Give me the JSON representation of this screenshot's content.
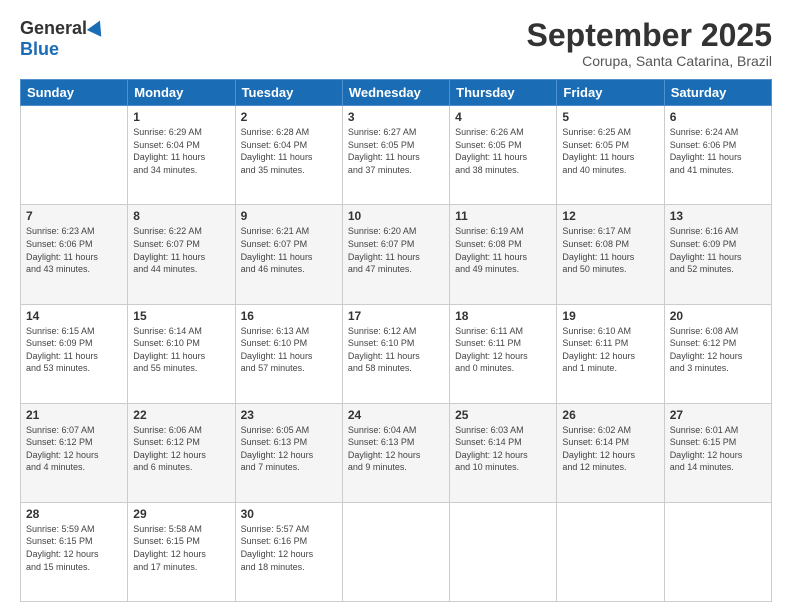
{
  "logo": {
    "general": "General",
    "blue": "Blue"
  },
  "header": {
    "month": "September 2025",
    "location": "Corupa, Santa Catarina, Brazil"
  },
  "weekdays": [
    "Sunday",
    "Monday",
    "Tuesday",
    "Wednesday",
    "Thursday",
    "Friday",
    "Saturday"
  ],
  "weeks": [
    [
      {
        "day": "",
        "info": ""
      },
      {
        "day": "1",
        "info": "Sunrise: 6:29 AM\nSunset: 6:04 PM\nDaylight: 11 hours\nand 34 minutes."
      },
      {
        "day": "2",
        "info": "Sunrise: 6:28 AM\nSunset: 6:04 PM\nDaylight: 11 hours\nand 35 minutes."
      },
      {
        "day": "3",
        "info": "Sunrise: 6:27 AM\nSunset: 6:05 PM\nDaylight: 11 hours\nand 37 minutes."
      },
      {
        "day": "4",
        "info": "Sunrise: 6:26 AM\nSunset: 6:05 PM\nDaylight: 11 hours\nand 38 minutes."
      },
      {
        "day": "5",
        "info": "Sunrise: 6:25 AM\nSunset: 6:05 PM\nDaylight: 11 hours\nand 40 minutes."
      },
      {
        "day": "6",
        "info": "Sunrise: 6:24 AM\nSunset: 6:06 PM\nDaylight: 11 hours\nand 41 minutes."
      }
    ],
    [
      {
        "day": "7",
        "info": "Sunrise: 6:23 AM\nSunset: 6:06 PM\nDaylight: 11 hours\nand 43 minutes."
      },
      {
        "day": "8",
        "info": "Sunrise: 6:22 AM\nSunset: 6:07 PM\nDaylight: 11 hours\nand 44 minutes."
      },
      {
        "day": "9",
        "info": "Sunrise: 6:21 AM\nSunset: 6:07 PM\nDaylight: 11 hours\nand 46 minutes."
      },
      {
        "day": "10",
        "info": "Sunrise: 6:20 AM\nSunset: 6:07 PM\nDaylight: 11 hours\nand 47 minutes."
      },
      {
        "day": "11",
        "info": "Sunrise: 6:19 AM\nSunset: 6:08 PM\nDaylight: 11 hours\nand 49 minutes."
      },
      {
        "day": "12",
        "info": "Sunrise: 6:17 AM\nSunset: 6:08 PM\nDaylight: 11 hours\nand 50 minutes."
      },
      {
        "day": "13",
        "info": "Sunrise: 6:16 AM\nSunset: 6:09 PM\nDaylight: 11 hours\nand 52 minutes."
      }
    ],
    [
      {
        "day": "14",
        "info": "Sunrise: 6:15 AM\nSunset: 6:09 PM\nDaylight: 11 hours\nand 53 minutes."
      },
      {
        "day": "15",
        "info": "Sunrise: 6:14 AM\nSunset: 6:10 PM\nDaylight: 11 hours\nand 55 minutes."
      },
      {
        "day": "16",
        "info": "Sunrise: 6:13 AM\nSunset: 6:10 PM\nDaylight: 11 hours\nand 57 minutes."
      },
      {
        "day": "17",
        "info": "Sunrise: 6:12 AM\nSunset: 6:10 PM\nDaylight: 11 hours\nand 58 minutes."
      },
      {
        "day": "18",
        "info": "Sunrise: 6:11 AM\nSunset: 6:11 PM\nDaylight: 12 hours\nand 0 minutes."
      },
      {
        "day": "19",
        "info": "Sunrise: 6:10 AM\nSunset: 6:11 PM\nDaylight: 12 hours\nand 1 minute."
      },
      {
        "day": "20",
        "info": "Sunrise: 6:08 AM\nSunset: 6:12 PM\nDaylight: 12 hours\nand 3 minutes."
      }
    ],
    [
      {
        "day": "21",
        "info": "Sunrise: 6:07 AM\nSunset: 6:12 PM\nDaylight: 12 hours\nand 4 minutes."
      },
      {
        "day": "22",
        "info": "Sunrise: 6:06 AM\nSunset: 6:12 PM\nDaylight: 12 hours\nand 6 minutes."
      },
      {
        "day": "23",
        "info": "Sunrise: 6:05 AM\nSunset: 6:13 PM\nDaylight: 12 hours\nand 7 minutes."
      },
      {
        "day": "24",
        "info": "Sunrise: 6:04 AM\nSunset: 6:13 PM\nDaylight: 12 hours\nand 9 minutes."
      },
      {
        "day": "25",
        "info": "Sunrise: 6:03 AM\nSunset: 6:14 PM\nDaylight: 12 hours\nand 10 minutes."
      },
      {
        "day": "26",
        "info": "Sunrise: 6:02 AM\nSunset: 6:14 PM\nDaylight: 12 hours\nand 12 minutes."
      },
      {
        "day": "27",
        "info": "Sunrise: 6:01 AM\nSunset: 6:15 PM\nDaylight: 12 hours\nand 14 minutes."
      }
    ],
    [
      {
        "day": "28",
        "info": "Sunrise: 5:59 AM\nSunset: 6:15 PM\nDaylight: 12 hours\nand 15 minutes."
      },
      {
        "day": "29",
        "info": "Sunrise: 5:58 AM\nSunset: 6:15 PM\nDaylight: 12 hours\nand 17 minutes."
      },
      {
        "day": "30",
        "info": "Sunrise: 5:57 AM\nSunset: 6:16 PM\nDaylight: 12 hours\nand 18 minutes."
      },
      {
        "day": "",
        "info": ""
      },
      {
        "day": "",
        "info": ""
      },
      {
        "day": "",
        "info": ""
      },
      {
        "day": "",
        "info": ""
      }
    ]
  ]
}
